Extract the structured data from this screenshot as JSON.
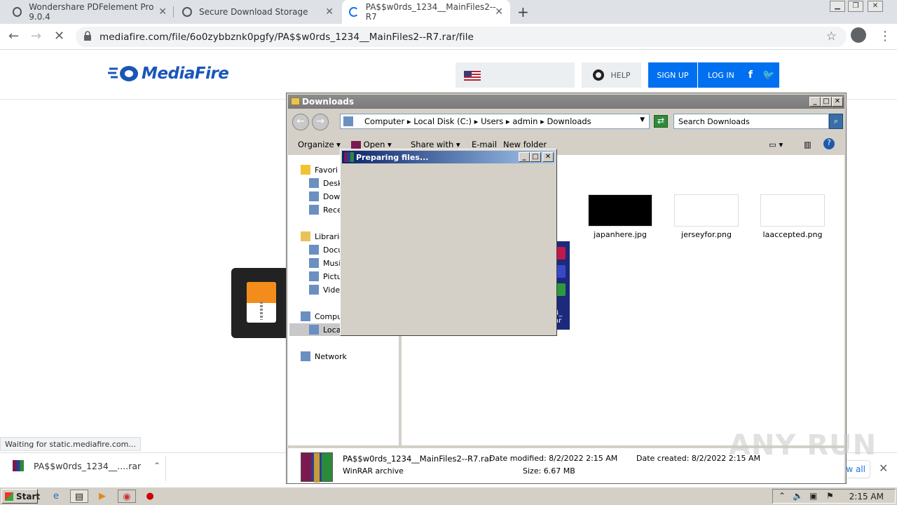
{
  "browser": {
    "tabs": [
      {
        "title": "Wondershare PDFelement Pro 9.0.4"
      },
      {
        "title": "Secure Download Storage"
      },
      {
        "title": "PA$$w0rds_1234__MainFiles2--R7"
      }
    ],
    "url": "mediafire.com/file/6o0zybbznk0pgfy/PA$$w0rds_1234__MainFiles2--R7.rar/file",
    "status_text": "Waiting for static.mediafire.com..."
  },
  "mediafire": {
    "logo_text": "MediaFire",
    "help_label": "HELP",
    "signup_label": "SIGN UP",
    "login_label": "LOG IN"
  },
  "download_shelf": {
    "file_label": "PA$$w0rds_1234__....rar",
    "show_all_label": "w all"
  },
  "explorer": {
    "title": "Downloads",
    "breadcrumb": [
      "Computer",
      "Local Disk (C:)",
      "Users",
      "admin",
      "Downloads"
    ],
    "search_placeholder": "Search Downloads",
    "commands": {
      "organize": "Organize",
      "open": "Open",
      "share": "Share with",
      "email": "E-mail",
      "new_folder": "New folder"
    },
    "nav": {
      "favorites": "Favori",
      "desktop": "Desk",
      "downloads": "Dow",
      "recent": "Rece",
      "libraries": "Librarie",
      "documents": "Docu",
      "music": "Musi",
      "pictures": "Pictu",
      "videos": "Vide",
      "computer": "Compu",
      "local": "Loca",
      "network": "Network"
    },
    "files": [
      {
        "name": "japanhere.jpg"
      },
      {
        "name": "jerseyfor.png"
      },
      {
        "name": "laaccepted.png"
      }
    ],
    "partial_rar_label_1": "4_",
    "partial_rar_label_2": "ar",
    "details": {
      "filename": "PA$$w0rds_1234__MainFiles2--R7.rar",
      "type": "WinRAR archive",
      "modified_label": "Date modified:",
      "modified_value": "8/2/2022 2:15 AM",
      "created_label": "Date created:",
      "created_value": "8/2/2022 2:15 AM",
      "size_label": "Size:",
      "size_value": "6.67 MB"
    }
  },
  "dialog": {
    "title": "Preparing files..."
  },
  "taskbar": {
    "start_label": "Start",
    "clock": "2:15 AM"
  },
  "watermark": "ANY RUN"
}
